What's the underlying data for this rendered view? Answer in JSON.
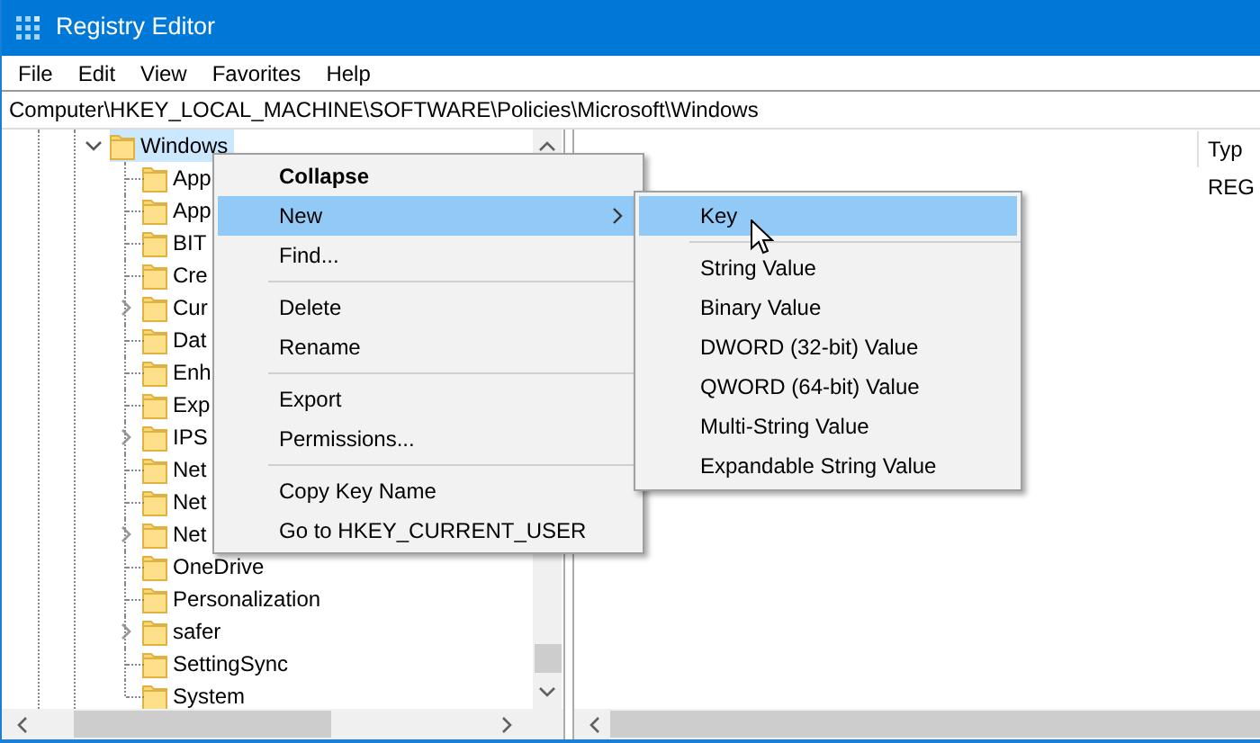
{
  "window": {
    "title": "Registry Editor"
  },
  "menu_bar": [
    "File",
    "Edit",
    "View",
    "Favorites",
    "Help"
  ],
  "address": "Computer\\HKEY_LOCAL_MACHINE\\SOFTWARE\\Policies\\Microsoft\\Windows",
  "tree": [
    {
      "label": "Windows",
      "expanded": true,
      "selected": true,
      "children": [
        {
          "label": "App",
          "expandable": false
        },
        {
          "label": "App",
          "expandable": false
        },
        {
          "label": "BIT",
          "expandable": false
        },
        {
          "label": "Cre",
          "expandable": false
        },
        {
          "label": "Cur",
          "expandable": true
        },
        {
          "label": "Dat",
          "expandable": false
        },
        {
          "label": "Enh",
          "expandable": false
        },
        {
          "label": "Exp",
          "expandable": false
        },
        {
          "label": "IPS",
          "expandable": true
        },
        {
          "label": "Net",
          "expandable": false
        },
        {
          "label": "Net",
          "expandable": false
        },
        {
          "label": "Net",
          "expandable": true
        },
        {
          "label": "OneDrive",
          "expandable": false
        },
        {
          "label": "Personalization",
          "expandable": false
        },
        {
          "label": "safer",
          "expandable": true
        },
        {
          "label": "SettingSync",
          "expandable": false
        },
        {
          "label": "System",
          "expandable": false
        }
      ]
    }
  ],
  "values_pane": {
    "columns": [
      "Typ"
    ],
    "rows": [
      {
        "column_2": "REG"
      }
    ]
  },
  "context_menu": {
    "items": [
      {
        "kind": "item",
        "label": "Collapse",
        "default": true,
        "selected": false,
        "submenu": false
      },
      {
        "kind": "item",
        "label": "New",
        "default": false,
        "selected": true,
        "submenu": true
      },
      {
        "kind": "item",
        "label": "Find...",
        "default": false,
        "selected": false,
        "submenu": false
      },
      {
        "kind": "separator"
      },
      {
        "kind": "item",
        "label": "Delete",
        "default": false,
        "selected": false,
        "submenu": false
      },
      {
        "kind": "item",
        "label": "Rename",
        "default": false,
        "selected": false,
        "submenu": false
      },
      {
        "kind": "separator"
      },
      {
        "kind": "item",
        "label": "Export",
        "default": false,
        "selected": false,
        "submenu": false
      },
      {
        "kind": "item",
        "label": "Permissions...",
        "default": false,
        "selected": false,
        "submenu": false
      },
      {
        "kind": "separator"
      },
      {
        "kind": "item",
        "label": "Copy Key Name",
        "default": false,
        "selected": false,
        "submenu": false
      },
      {
        "kind": "item",
        "label": "Go to HKEY_CURRENT_USER",
        "default": false,
        "selected": false,
        "submenu": false
      }
    ]
  },
  "submenu": {
    "items": [
      {
        "kind": "item",
        "label": "Key",
        "selected": true
      },
      {
        "kind": "separator"
      },
      {
        "kind": "item",
        "label": "String Value",
        "selected": false
      },
      {
        "kind": "item",
        "label": "Binary Value",
        "selected": false
      },
      {
        "kind": "item",
        "label": "DWORD (32-bit) Value",
        "selected": false
      },
      {
        "kind": "item",
        "label": "QWORD (64-bit) Value",
        "selected": false
      },
      {
        "kind": "item",
        "label": "Multi-String Value",
        "selected": false
      },
      {
        "kind": "item",
        "label": "Expandable String Value",
        "selected": false
      }
    ]
  }
}
